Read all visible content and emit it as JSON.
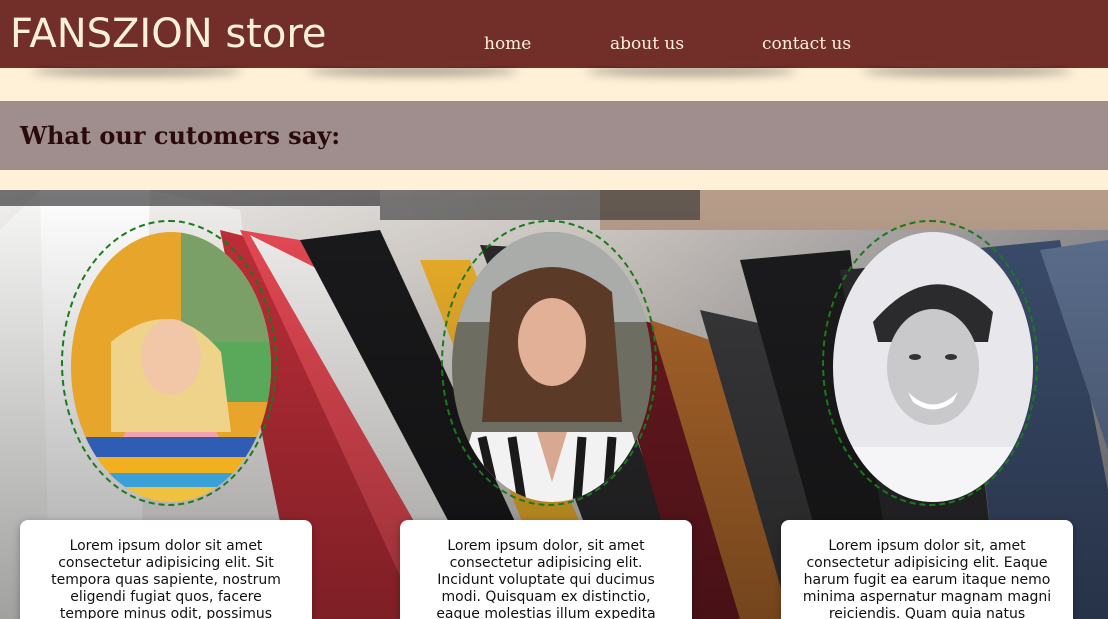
{
  "header": {
    "brand": "FANSZION store",
    "nav": [
      "home",
      "about us",
      "contact us"
    ]
  },
  "section": {
    "title": "What our cutomers say:"
  },
  "testimonials": [
    {
      "avatar": "woman-striped-sweater-portrait",
      "text": "Lorem ipsum dolor sit amet consectetur adipisicing elit. Sit tempora quas sapiente, nostrum eligendi fugiat quos, facere tempore minus odit, possimus"
    },
    {
      "avatar": "woman-striped-shirt-portrait",
      "text": "Lorem ipsum dolor, sit amet consectetur adipisicing elit. Incidunt voluptate qui ducimus modi. Quisquam ex distinctio, eaque molestias illum expedita"
    },
    {
      "avatar": "smiling-man-bw-portrait",
      "text": "Lorem ipsum dolor sit, amet consectetur adipisicing elit. Eaque harum fugit ea earum itaque nemo minima aspernatur magnam magni reiciendis. Quam quia natus"
    }
  ],
  "colors": {
    "header_bg": "#722f29",
    "page_bg": "#fff1d8",
    "section_bg": "#a08d8d",
    "ring": "#1a7a1a"
  }
}
